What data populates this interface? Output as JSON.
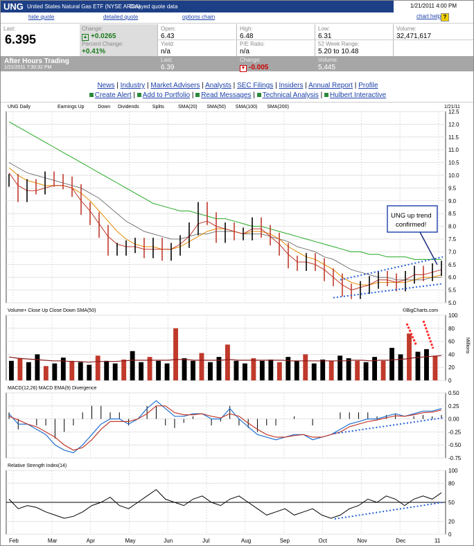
{
  "header": {
    "symbol": "UNG",
    "name": "United States Natural Gas ETF (NYSE ARCA)",
    "delay": "Delayed quote data",
    "date": "1/21/2011 4:00 PM"
  },
  "links": {
    "hide_quote": "hide quote",
    "detailed_quote": "detailed quote",
    "options_chain": "options chain",
    "chart_help": "chart help",
    "help_q": "?"
  },
  "quote": {
    "last_label": "Last:",
    "last": "6.395",
    "change_label": "Change:",
    "change": "+0.0265",
    "pct_label": "Percent Change:",
    "pct": "+0.41%",
    "open_label": "Open:",
    "open": "6.43",
    "high_label": "High:",
    "high": "6.48",
    "low_label": "Low:",
    "low": "6.31",
    "volume_label": "Volume:",
    "volume": "32,471,617",
    "yield_label": "Yield:",
    "yield": "n/a",
    "pe_label": "P/E Ratio:",
    "pe": "n/a",
    "range_label": "52 Week Range:",
    "range": "5.20 to 10.48"
  },
  "after_hours": {
    "title": "After Hours Trading",
    "time": "1/21/2011 7:30:32 PM",
    "last_label": "Last:",
    "last": "6.39",
    "change_label": "Change:",
    "change": "-0.005",
    "volume_label": "Volume:",
    "volume": "5,445"
  },
  "nav": {
    "row1": [
      "News",
      "Industry",
      "Market Advisers",
      "Analysts",
      "SEC Filings",
      "Insiders",
      "Annual Report",
      "Profile"
    ],
    "row2": [
      "Create Alert",
      "Add to Portfolio",
      "Read Messages",
      "Technical Analysis",
      "Hulbert Interactive"
    ]
  },
  "colors": {
    "price": "#000000",
    "sma20": "#c0392b",
    "sma50": "#e68a00",
    "sma100": "#777777",
    "sma200": "#22aa22",
    "macd": "#1f6fd1",
    "ema": "#c0392b",
    "trend": "#1f5fd8",
    "annotation_arrow": "#ff2a2a"
  },
  "chart_data": [
    {
      "type": "line",
      "panel": "price",
      "title": "UNG Daily",
      "date_label": "1/21/11",
      "legend": [
        "Earnings Up",
        "Down",
        "Dividends",
        "Splits",
        "SMA(20)",
        "SMA(50)",
        "SMA(100)",
        "SMA(200)"
      ],
      "ylim": [
        5.0,
        12.5
      ],
      "yticks": [
        "12.5",
        "12.0",
        "11.5",
        "11.0",
        "10.5",
        "10.0",
        "9.5",
        "9.0",
        "8.5",
        "8.0",
        "7.5",
        "7.0",
        "6.5",
        "6.0",
        "5.5",
        "5.0"
      ],
      "months": [
        "Feb",
        "Mar",
        "Apr",
        "May",
        "Jun",
        "Jul",
        "Aug",
        "Sep",
        "Oct",
        "Nov",
        "Dec",
        "11"
      ],
      "annotation": "UNG up trend confirmed!",
      "watermark": "©BigCharts.com",
      "close": [
        9.8,
        9.2,
        9.6,
        9.5,
        9.9,
        9.8,
        9.7,
        9.4,
        8.7,
        8.3,
        7.8,
        7.1,
        7.1,
        7.2,
        7.3,
        7.0,
        7.3,
        6.9,
        7.1,
        7.4,
        7.9,
        8.7,
        8.3,
        7.6,
        7.9,
        7.7,
        7.7,
        8.1,
        7.8,
        7.5,
        7.1,
        6.6,
        6.5,
        6.7,
        6.5,
        6.1,
        5.9,
        5.5,
        5.4,
        5.6,
        5.8,
        6.0,
        5.9,
        5.7,
        6.0,
        6.2,
        6.1,
        6.3,
        6.4
      ],
      "sma20": [
        10.1,
        9.6,
        9.4,
        9.4,
        9.5,
        9.6,
        9.6,
        9.5,
        9.0,
        8.6,
        8.1,
        7.6,
        7.3,
        7.2,
        7.2,
        7.1,
        7.1,
        7.1,
        7.1,
        7.3,
        7.6,
        8.1,
        8.2,
        8.0,
        7.9,
        7.8,
        7.7,
        7.9,
        7.9,
        7.6,
        7.3,
        6.9,
        6.6,
        6.6,
        6.5,
        6.3,
        6.0,
        5.7,
        5.5,
        5.6,
        5.7,
        5.9,
        5.9,
        5.8,
        5.9,
        6.1,
        6.1,
        6.2,
        6.3
      ],
      "sma50": [
        10.3,
        10.0,
        9.8,
        9.7,
        9.6,
        9.6,
        9.6,
        9.5,
        9.3,
        9.0,
        8.6,
        8.2,
        7.8,
        7.5,
        7.3,
        7.2,
        7.2,
        7.1,
        7.1,
        7.2,
        7.4,
        7.6,
        7.8,
        7.9,
        7.9,
        7.8,
        7.7,
        7.8,
        7.8,
        7.7,
        7.5,
        7.2,
        7.0,
        6.8,
        6.7,
        6.5,
        6.3,
        6.0,
        5.8,
        5.7,
        5.7,
        5.8,
        5.8,
        5.8,
        5.8,
        5.9,
        6.0,
        6.0,
        6.1
      ],
      "sma100": [
        10.5,
        10.3,
        10.1,
        10.0,
        9.9,
        9.8,
        9.7,
        9.6,
        9.5,
        9.3,
        9.1,
        8.8,
        8.5,
        8.2,
        8.0,
        7.8,
        7.7,
        7.6,
        7.5,
        7.5,
        7.6,
        7.7,
        7.7,
        7.8,
        7.8,
        7.8,
        7.7,
        7.7,
        7.7,
        7.6,
        7.5,
        7.4,
        7.2,
        7.1,
        7.0,
        6.8,
        6.7,
        6.5,
        6.3,
        6.2,
        6.1,
        6.0,
        6.0,
        5.9,
        5.9,
        5.9,
        5.9,
        6.0,
        6.0
      ],
      "sma200": [
        12.1,
        11.9,
        11.7,
        11.5,
        11.3,
        11.1,
        10.9,
        10.7,
        10.5,
        10.3,
        10.1,
        9.9,
        9.7,
        9.5,
        9.3,
        9.1,
        8.9,
        8.8,
        8.7,
        8.6,
        8.6,
        8.5,
        8.4,
        8.3,
        8.3,
        8.2,
        8.1,
        8.0,
        8.0,
        7.9,
        7.8,
        7.7,
        7.6,
        7.5,
        7.4,
        7.3,
        7.2,
        7.1,
        7.0,
        7.0,
        6.9,
        6.9,
        6.8,
        6.8,
        6.8,
        6.7,
        6.7,
        6.7,
        6.7
      ]
    },
    {
      "type": "bar",
      "panel": "volume",
      "legend": [
        "Volume+",
        "Close Up",
        "Close Down",
        "SMA(50)"
      ],
      "ylabel": "Millions",
      "ylim": [
        0,
        100
      ],
      "yticks": [
        "100",
        "80",
        "60",
        "40",
        "20",
        "0"
      ],
      "volume": [
        30,
        34,
        28,
        40,
        22,
        26,
        35,
        30,
        28,
        24,
        38,
        30,
        26,
        32,
        45,
        28,
        36,
        30,
        26,
        80,
        34,
        30,
        42,
        28,
        36,
        55,
        30,
        26,
        34,
        30,
        32,
        28,
        36,
        30,
        40,
        26,
        32,
        30,
        38,
        34,
        30,
        28,
        36,
        30,
        50,
        40,
        72,
        44,
        48,
        38
      ],
      "vol_sma": [
        36,
        34,
        33,
        32,
        31,
        30,
        30,
        29,
        29,
        28,
        29,
        29,
        29,
        30,
        31,
        31,
        31,
        31,
        31,
        32,
        32,
        31,
        31,
        31,
        31,
        32,
        31,
        31,
        31,
        31,
        31,
        31,
        30,
        30,
        30,
        30,
        30,
        30,
        30,
        31,
        31,
        30,
        31,
        31,
        32,
        33,
        35,
        36,
        37,
        38
      ]
    },
    {
      "type": "line",
      "panel": "macd",
      "legend": [
        "MACD(12,26)",
        "MACD EMA(9)",
        "Divergence"
      ],
      "ylim": [
        -0.75,
        0.5
      ],
      "yticks": [
        "0.50",
        "0.25",
        "0.00",
        "-0.25",
        "-0.50",
        "-0.75"
      ],
      "macd": [
        0.1,
        -0.1,
        -0.1,
        -0.2,
        -0.3,
        -0.5,
        -0.6,
        -0.65,
        -0.5,
        -0.3,
        -0.1,
        0.0,
        0.0,
        -0.1,
        0.0,
        0.2,
        0.35,
        0.2,
        0.05,
        0.05,
        0.1,
        0.1,
        0.0,
        0.0,
        0.2,
        0.0,
        -0.15,
        -0.3,
        -0.35,
        -0.4,
        -0.35,
        -0.3,
        -0.3,
        -0.4,
        -0.35,
        -0.3,
        -0.2,
        -0.1,
        -0.05,
        0.0,
        0.0,
        0.05,
        0.1,
        0.05,
        0.1,
        0.15,
        0.15,
        0.2
      ],
      "ema": [
        0.05,
        -0.02,
        -0.1,
        -0.15,
        -0.25,
        -0.35,
        -0.5,
        -0.6,
        -0.55,
        -0.4,
        -0.2,
        -0.05,
        -0.05,
        -0.05,
        0.0,
        0.1,
        0.25,
        0.25,
        0.12,
        0.08,
        0.08,
        0.1,
        0.05,
        0.02,
        0.1,
        0.05,
        -0.08,
        -0.2,
        -0.3,
        -0.35,
        -0.35,
        -0.32,
        -0.3,
        -0.35,
        -0.35,
        -0.3,
        -0.25,
        -0.15,
        -0.1,
        -0.05,
        -0.02,
        0.02,
        0.06,
        0.05,
        0.08,
        0.12,
        0.13,
        0.17
      ]
    },
    {
      "type": "line",
      "panel": "rsi",
      "title": "Relative Strength Index(14)",
      "ylim": [
        0,
        100
      ],
      "yticks": [
        "100",
        "80",
        "50",
        "20",
        "0"
      ],
      "rsi": [
        55,
        40,
        45,
        42,
        35,
        30,
        25,
        28,
        35,
        45,
        50,
        58,
        45,
        40,
        50,
        60,
        70,
        55,
        50,
        45,
        55,
        60,
        50,
        45,
        55,
        60,
        50,
        40,
        30,
        35,
        40,
        30,
        35,
        40,
        30,
        25,
        30,
        40,
        45,
        55,
        50,
        60,
        55,
        45,
        55,
        60,
        55,
        65
      ]
    }
  ]
}
